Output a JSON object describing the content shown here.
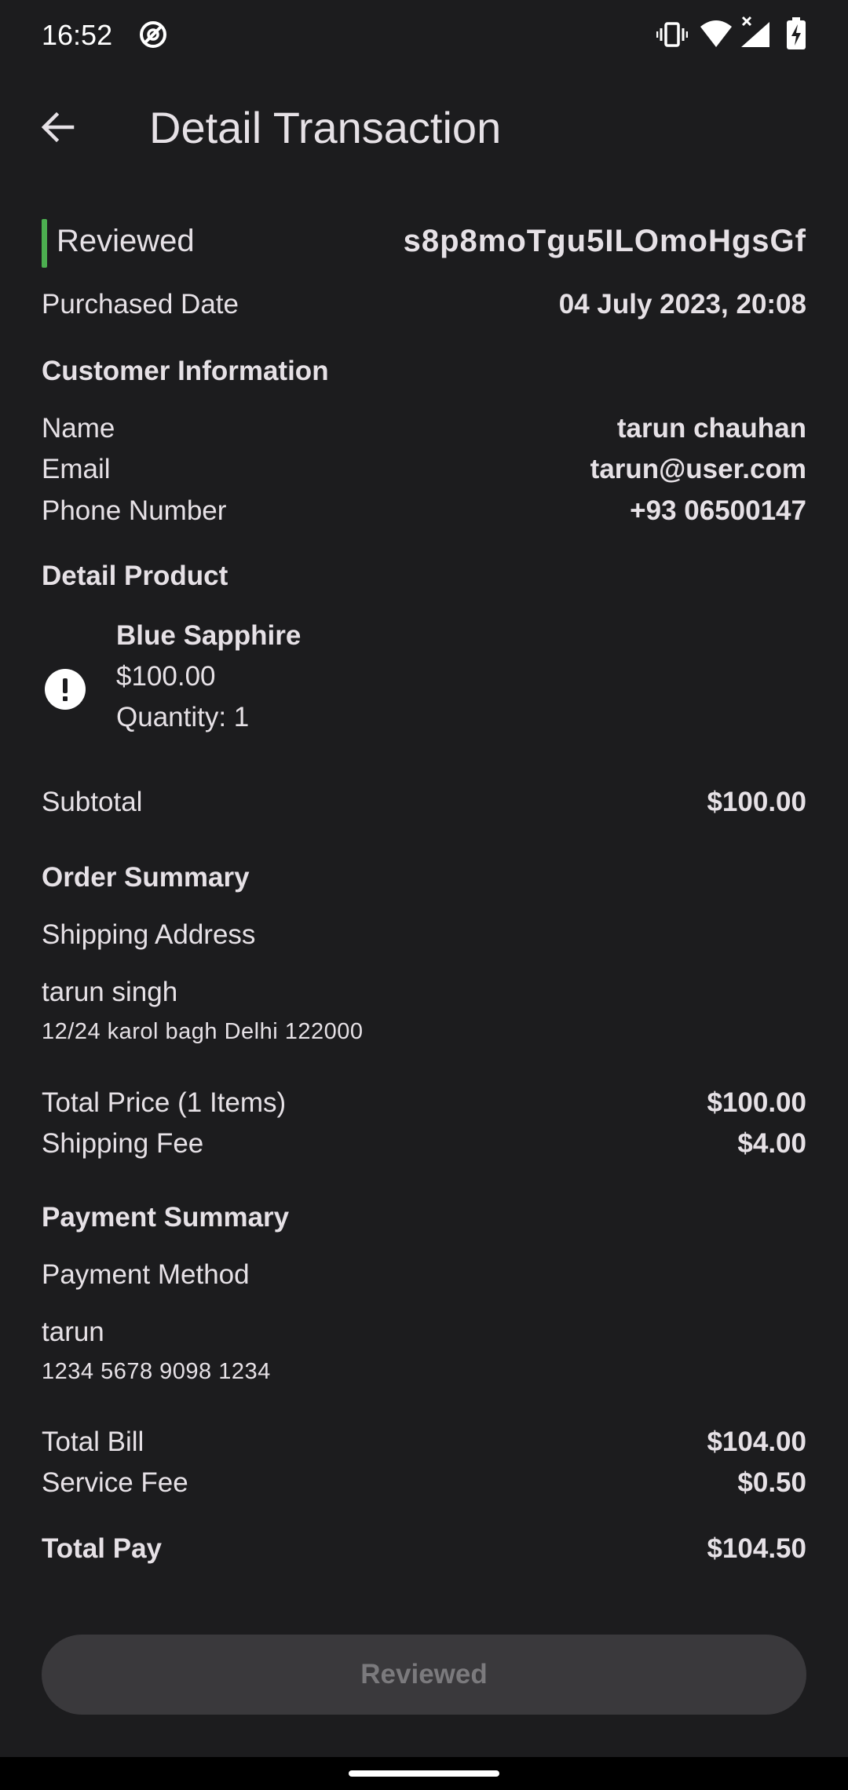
{
  "status_bar": {
    "time": "16:52"
  },
  "app_bar": {
    "title": "Detail Transaction"
  },
  "transaction": {
    "status": "Reviewed",
    "status_color": "#4caf50",
    "id": "s8p8moTgu5ILOmoHgsGf",
    "purchased_date_label": "Purchased Date",
    "purchased_date": "04 July 2023, 20:08"
  },
  "customer": {
    "title": "Customer Information",
    "name_label": "Name",
    "name": "tarun chauhan",
    "email_label": "Email",
    "email": "tarun@user.com",
    "phone_label": "Phone Number",
    "phone": "+93 06500147"
  },
  "product": {
    "title": "Detail Product",
    "name": "Blue Sapphire",
    "price": "$100.00",
    "quantity": "Quantity: 1",
    "image_icon": "error-icon",
    "subtotal_label": "Subtotal",
    "subtotal": "$100.00"
  },
  "order_summary": {
    "title": "Order Summary",
    "shipping_address_label": "Shipping Address",
    "recipient": "tarun singh",
    "address": "12/24 karol bagh Delhi 122000",
    "total_price_label": "Total Price (1 Items)",
    "total_price": "$100.00",
    "shipping_fee_label": "Shipping Fee",
    "shipping_fee": "$4.00"
  },
  "payment_summary": {
    "title": "Payment Summary",
    "method_label": "Payment Method",
    "card_holder": "tarun",
    "card_number": "1234 5678 9098 1234",
    "total_bill_label": "Total Bill",
    "total_bill": "$104.00",
    "service_fee_label": "Service Fee",
    "service_fee": "$0.50",
    "total_pay_label": "Total Pay",
    "total_pay": "$104.50"
  },
  "footer": {
    "button_label": "Reviewed"
  }
}
